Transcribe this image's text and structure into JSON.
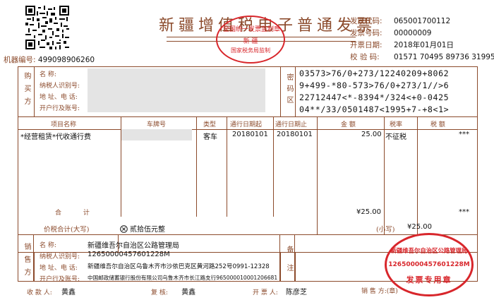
{
  "header": {
    "title": "新疆增值税电子普通发票",
    "machine_no_label": "机器编号:",
    "machine_no": "499098906260",
    "invoice_code_label": "发票代码:",
    "invoice_code": "065001700112",
    "invoice_no_label": "发票号码:",
    "invoice_no": "00000009",
    "date_label": "开票日期:",
    "date": "2018年01月01日",
    "check_label": "校 验 码:",
    "check_code": "01571 70495 89736 31995"
  },
  "title_stamp": {
    "line1": "全国统一发票监制章",
    "line2": "新 疆",
    "line3": "国家税务局监制"
  },
  "buyer": {
    "section_label": "购买方",
    "name_label": "名 称:",
    "tax_id_label": "纳税人识别号:",
    "address_label": "地 址、电 话:",
    "bank_label": "开户行及账号:"
  },
  "cipher": {
    "section_label": "密码区",
    "lines": [
      "03573>76/0+273/12240209+8062",
      "9+499-*80-573>76/0+273/1//>6",
      "22712447<*-8394*/324<+0-0425",
      "04**/33/0501487<1995+7-+8<1>"
    ]
  },
  "items": {
    "headers": [
      "项目名称",
      "车牌号",
      "类型",
      "通行日期起",
      "通行日期止",
      "金 额",
      "税率",
      "税 额"
    ],
    "rows": [
      {
        "name": "*经营租赁*代收通行费",
        "plate": "",
        "type": "客车",
        "date_from": "20180101",
        "date_to": "20180101",
        "amount": "25.00",
        "rate": "不征税",
        "tax": "***"
      }
    ],
    "total_label": "合 计",
    "total_amount": "¥25.00",
    "total_tax": "***"
  },
  "grand_total": {
    "label": "价税合计(大写)",
    "words": "贰拾伍元整",
    "small_label": "(小写)",
    "small_value": "¥25.00"
  },
  "seller": {
    "section_label": "销售方",
    "name_label": "名 称:",
    "name": "新疆维吾尔自治区公路管理局",
    "tax_id_label": "纳税人识别号:",
    "tax_id": "12650000457601228M",
    "address_label": "地 址、电 话:",
    "address": "新疆维吾尔自治区乌鲁木齐市沙依巴克区黄河路252号0991-12328",
    "bank_label": "开户行及账号:",
    "bank": "中国邮政储蓄银行股份有限公司乌鲁木齐市长江路支行965000010001206681"
  },
  "remarks_label": "备注",
  "seller_stamp": {
    "name": "新疆维吾尔自治区公路管理局",
    "tax_id": "12650000457601228M",
    "kind": "发票专用章"
  },
  "footer": {
    "payee_label": "收 款 人:",
    "payee": "黄鑫",
    "reviewer_label": "复 核:",
    "reviewer": "黄鑫",
    "issuer_label": "开 票 人:",
    "issuer": "陈彦芝",
    "seller_label": "销 售 方:(章)"
  },
  "colors": {
    "frame": "#8b4a2b",
    "stamp": "#d8262b"
  }
}
